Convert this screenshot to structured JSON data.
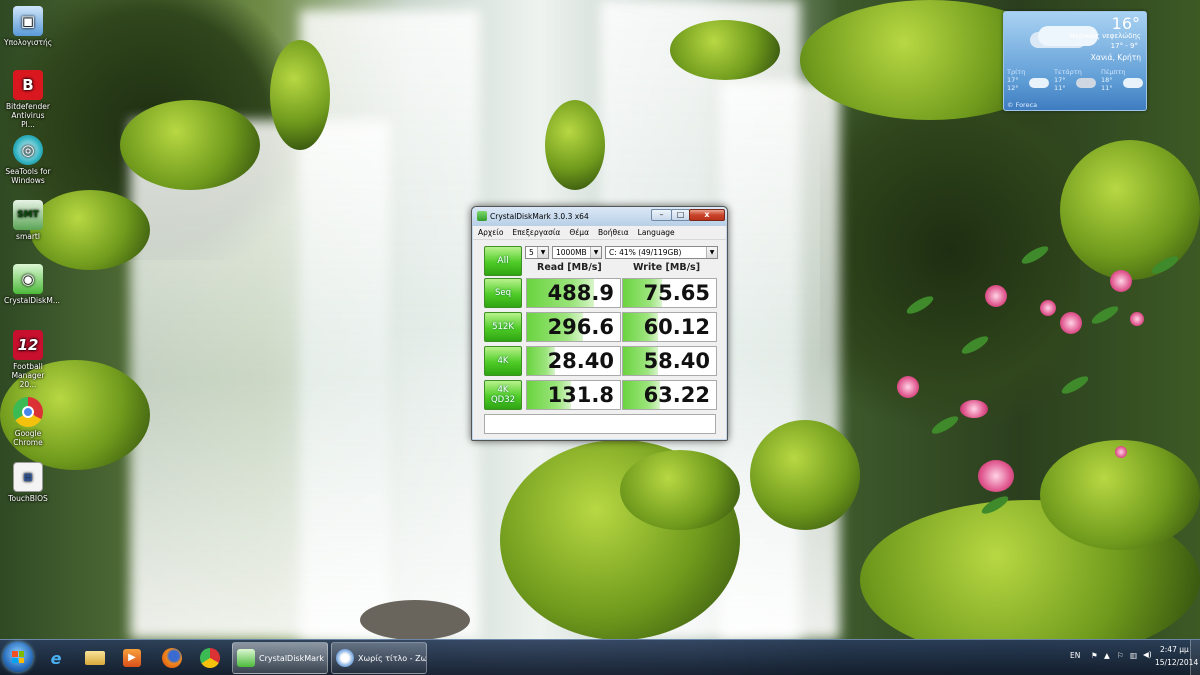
{
  "desktop": {
    "icons": [
      {
        "label": "Υπολογιστής",
        "icon": "computer-icon",
        "color": "#5aa0e0"
      },
      {
        "label": "Bitdefender Antivirus Pl...",
        "icon": "bitdefender-icon",
        "color": "#d8171f"
      },
      {
        "label": "SeaTools for Windows",
        "icon": "seatools-icon",
        "color": "#27a0a8"
      },
      {
        "label": "smartl",
        "icon": "smart-icon",
        "color": "#3e8a3a"
      },
      {
        "label": "CrystalDiskM...",
        "icon": "crystaldiskmark-icon",
        "color": "#4cba3a"
      },
      {
        "label": "Football Manager 20...",
        "icon": "football-manager-icon",
        "color": "#c8102e"
      },
      {
        "label": "Google Chrome",
        "icon": "chrome-icon",
        "color": "#e0402e"
      },
      {
        "label": "TouchBIOS",
        "icon": "touchbios-icon",
        "color": "#e8e8e8"
      }
    ]
  },
  "weather": {
    "temperature": "16°",
    "condition": "Μερικώς νεφελώδης",
    "hilo": "17° - 9°",
    "location": "Χανιά, Κρήτη",
    "forecast": [
      {
        "day": "Τρίτη",
        "hi": "17°",
        "lo": "12°"
      },
      {
        "day": "Τετάρτη",
        "hi": "17°",
        "lo": "11°"
      },
      {
        "day": "Πέμπτη",
        "hi": "18°",
        "lo": "11°"
      }
    ],
    "brand": "© Foreca"
  },
  "window": {
    "title": "CrystalDiskMark 3.0.3 x64",
    "controls": {
      "minimize": "–",
      "maximize": "□",
      "close": "x"
    },
    "menu": [
      "Αρχείο",
      "Επεξεργασία",
      "Θέμα",
      "Βοήθεια",
      "Language"
    ],
    "all_button": "All",
    "runs": "5",
    "size": "1000MB",
    "drive": "C: 41% (49/119GB)",
    "read_header": "Read [MB/s]",
    "write_header": "Write [MB/s]",
    "rows": [
      {
        "label": "Seq",
        "sublabel": "",
        "read": "488.9",
        "write": "75.65",
        "read_fill": 0.72,
        "write_fill": 0.42
      },
      {
        "label": "512K",
        "sublabel": "",
        "read": "296.6",
        "write": "60.12",
        "read_fill": 0.6,
        "write_fill": 0.38
      },
      {
        "label": "4K",
        "sublabel": "",
        "read": "28.40",
        "write": "58.40",
        "read_fill": 0.3,
        "write_fill": 0.38
      },
      {
        "label": "4K",
        "sublabel": "QD32",
        "read": "131.8",
        "write": "63.22",
        "read_fill": 0.47,
        "write_fill": 0.4
      }
    ],
    "comment": ""
  },
  "taskbar": {
    "pinned": [
      "ie-icon",
      "explorer-icon",
      "media-player-icon",
      "firefox-icon",
      "chrome-icon"
    ],
    "tasks": [
      {
        "label": "CrystalDiskMark 3...",
        "icon": "crystaldiskmark-icon",
        "active": true
      },
      {
        "label": "Χωρίς τίτλο - Ζω...",
        "icon": "paint-icon",
        "active": false
      }
    ],
    "language": "EN",
    "time": "2:47 μμ",
    "date": "15/12/2014"
  },
  "colors": {
    "benchmark_green": "#4fcc27",
    "close_red": "#c9432a",
    "taskbar": "#1c2b44",
    "weather_blue": "#5f9dd6"
  }
}
